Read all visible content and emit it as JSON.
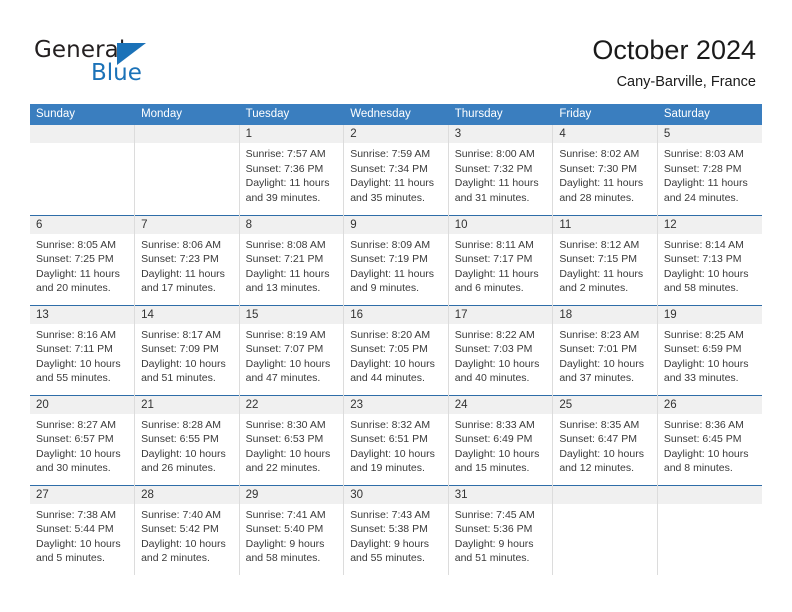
{
  "brand": {
    "name_top": "General",
    "name_bottom": "Blue",
    "triangle_color": "#1b72b8",
    "text_color": "#231f20"
  },
  "header": {
    "title": "October 2024",
    "subtitle": "Cany-Barville, France"
  },
  "theme": {
    "header_blue": "#3a7ebf",
    "row_divider_blue": "#2f6da8",
    "daynum_band": "#f0f0f0",
    "cell_border": "#dcdcdc"
  },
  "weekdays": [
    "Sunday",
    "Monday",
    "Tuesday",
    "Wednesday",
    "Thursday",
    "Friday",
    "Saturday"
  ],
  "weeks": [
    [
      {
        "day": "",
        "sunrise": "",
        "sunset": "",
        "daylight1": "",
        "daylight2": ""
      },
      {
        "day": "",
        "sunrise": "",
        "sunset": "",
        "daylight1": "",
        "daylight2": ""
      },
      {
        "day": "1",
        "sunrise": "Sunrise: 7:57 AM",
        "sunset": "Sunset: 7:36 PM",
        "daylight1": "Daylight: 11 hours",
        "daylight2": "and 39 minutes."
      },
      {
        "day": "2",
        "sunrise": "Sunrise: 7:59 AM",
        "sunset": "Sunset: 7:34 PM",
        "daylight1": "Daylight: 11 hours",
        "daylight2": "and 35 minutes."
      },
      {
        "day": "3",
        "sunrise": "Sunrise: 8:00 AM",
        "sunset": "Sunset: 7:32 PM",
        "daylight1": "Daylight: 11 hours",
        "daylight2": "and 31 minutes."
      },
      {
        "day": "4",
        "sunrise": "Sunrise: 8:02 AM",
        "sunset": "Sunset: 7:30 PM",
        "daylight1": "Daylight: 11 hours",
        "daylight2": "and 28 minutes."
      },
      {
        "day": "5",
        "sunrise": "Sunrise: 8:03 AM",
        "sunset": "Sunset: 7:28 PM",
        "daylight1": "Daylight: 11 hours",
        "daylight2": "and 24 minutes."
      }
    ],
    [
      {
        "day": "6",
        "sunrise": "Sunrise: 8:05 AM",
        "sunset": "Sunset: 7:25 PM",
        "daylight1": "Daylight: 11 hours",
        "daylight2": "and 20 minutes."
      },
      {
        "day": "7",
        "sunrise": "Sunrise: 8:06 AM",
        "sunset": "Sunset: 7:23 PM",
        "daylight1": "Daylight: 11 hours",
        "daylight2": "and 17 minutes."
      },
      {
        "day": "8",
        "sunrise": "Sunrise: 8:08 AM",
        "sunset": "Sunset: 7:21 PM",
        "daylight1": "Daylight: 11 hours",
        "daylight2": "and 13 minutes."
      },
      {
        "day": "9",
        "sunrise": "Sunrise: 8:09 AM",
        "sunset": "Sunset: 7:19 PM",
        "daylight1": "Daylight: 11 hours",
        "daylight2": "and 9 minutes."
      },
      {
        "day": "10",
        "sunrise": "Sunrise: 8:11 AM",
        "sunset": "Sunset: 7:17 PM",
        "daylight1": "Daylight: 11 hours",
        "daylight2": "and 6 minutes."
      },
      {
        "day": "11",
        "sunrise": "Sunrise: 8:12 AM",
        "sunset": "Sunset: 7:15 PM",
        "daylight1": "Daylight: 11 hours",
        "daylight2": "and 2 minutes."
      },
      {
        "day": "12",
        "sunrise": "Sunrise: 8:14 AM",
        "sunset": "Sunset: 7:13 PM",
        "daylight1": "Daylight: 10 hours",
        "daylight2": "and 58 minutes."
      }
    ],
    [
      {
        "day": "13",
        "sunrise": "Sunrise: 8:16 AM",
        "sunset": "Sunset: 7:11 PM",
        "daylight1": "Daylight: 10 hours",
        "daylight2": "and 55 minutes."
      },
      {
        "day": "14",
        "sunrise": "Sunrise: 8:17 AM",
        "sunset": "Sunset: 7:09 PM",
        "daylight1": "Daylight: 10 hours",
        "daylight2": "and 51 minutes."
      },
      {
        "day": "15",
        "sunrise": "Sunrise: 8:19 AM",
        "sunset": "Sunset: 7:07 PM",
        "daylight1": "Daylight: 10 hours",
        "daylight2": "and 47 minutes."
      },
      {
        "day": "16",
        "sunrise": "Sunrise: 8:20 AM",
        "sunset": "Sunset: 7:05 PM",
        "daylight1": "Daylight: 10 hours",
        "daylight2": "and 44 minutes."
      },
      {
        "day": "17",
        "sunrise": "Sunrise: 8:22 AM",
        "sunset": "Sunset: 7:03 PM",
        "daylight1": "Daylight: 10 hours",
        "daylight2": "and 40 minutes."
      },
      {
        "day": "18",
        "sunrise": "Sunrise: 8:23 AM",
        "sunset": "Sunset: 7:01 PM",
        "daylight1": "Daylight: 10 hours",
        "daylight2": "and 37 minutes."
      },
      {
        "day": "19",
        "sunrise": "Sunrise: 8:25 AM",
        "sunset": "Sunset: 6:59 PM",
        "daylight1": "Daylight: 10 hours",
        "daylight2": "and 33 minutes."
      }
    ],
    [
      {
        "day": "20",
        "sunrise": "Sunrise: 8:27 AM",
        "sunset": "Sunset: 6:57 PM",
        "daylight1": "Daylight: 10 hours",
        "daylight2": "and 30 minutes."
      },
      {
        "day": "21",
        "sunrise": "Sunrise: 8:28 AM",
        "sunset": "Sunset: 6:55 PM",
        "daylight1": "Daylight: 10 hours",
        "daylight2": "and 26 minutes."
      },
      {
        "day": "22",
        "sunrise": "Sunrise: 8:30 AM",
        "sunset": "Sunset: 6:53 PM",
        "daylight1": "Daylight: 10 hours",
        "daylight2": "and 22 minutes."
      },
      {
        "day": "23",
        "sunrise": "Sunrise: 8:32 AM",
        "sunset": "Sunset: 6:51 PM",
        "daylight1": "Daylight: 10 hours",
        "daylight2": "and 19 minutes."
      },
      {
        "day": "24",
        "sunrise": "Sunrise: 8:33 AM",
        "sunset": "Sunset: 6:49 PM",
        "daylight1": "Daylight: 10 hours",
        "daylight2": "and 15 minutes."
      },
      {
        "day": "25",
        "sunrise": "Sunrise: 8:35 AM",
        "sunset": "Sunset: 6:47 PM",
        "daylight1": "Daylight: 10 hours",
        "daylight2": "and 12 minutes."
      },
      {
        "day": "26",
        "sunrise": "Sunrise: 8:36 AM",
        "sunset": "Sunset: 6:45 PM",
        "daylight1": "Daylight: 10 hours",
        "daylight2": "and 8 minutes."
      }
    ],
    [
      {
        "day": "27",
        "sunrise": "Sunrise: 7:38 AM",
        "sunset": "Sunset: 5:44 PM",
        "daylight1": "Daylight: 10 hours",
        "daylight2": "and 5 minutes."
      },
      {
        "day": "28",
        "sunrise": "Sunrise: 7:40 AM",
        "sunset": "Sunset: 5:42 PM",
        "daylight1": "Daylight: 10 hours",
        "daylight2": "and 2 minutes."
      },
      {
        "day": "29",
        "sunrise": "Sunrise: 7:41 AM",
        "sunset": "Sunset: 5:40 PM",
        "daylight1": "Daylight: 9 hours",
        "daylight2": "and 58 minutes."
      },
      {
        "day": "30",
        "sunrise": "Sunrise: 7:43 AM",
        "sunset": "Sunset: 5:38 PM",
        "daylight1": "Daylight: 9 hours",
        "daylight2": "and 55 minutes."
      },
      {
        "day": "31",
        "sunrise": "Sunrise: 7:45 AM",
        "sunset": "Sunset: 5:36 PM",
        "daylight1": "Daylight: 9 hours",
        "daylight2": "and 51 minutes."
      },
      {
        "day": "",
        "sunrise": "",
        "sunset": "",
        "daylight1": "",
        "daylight2": ""
      },
      {
        "day": "",
        "sunrise": "",
        "sunset": "",
        "daylight1": "",
        "daylight2": ""
      }
    ]
  ]
}
